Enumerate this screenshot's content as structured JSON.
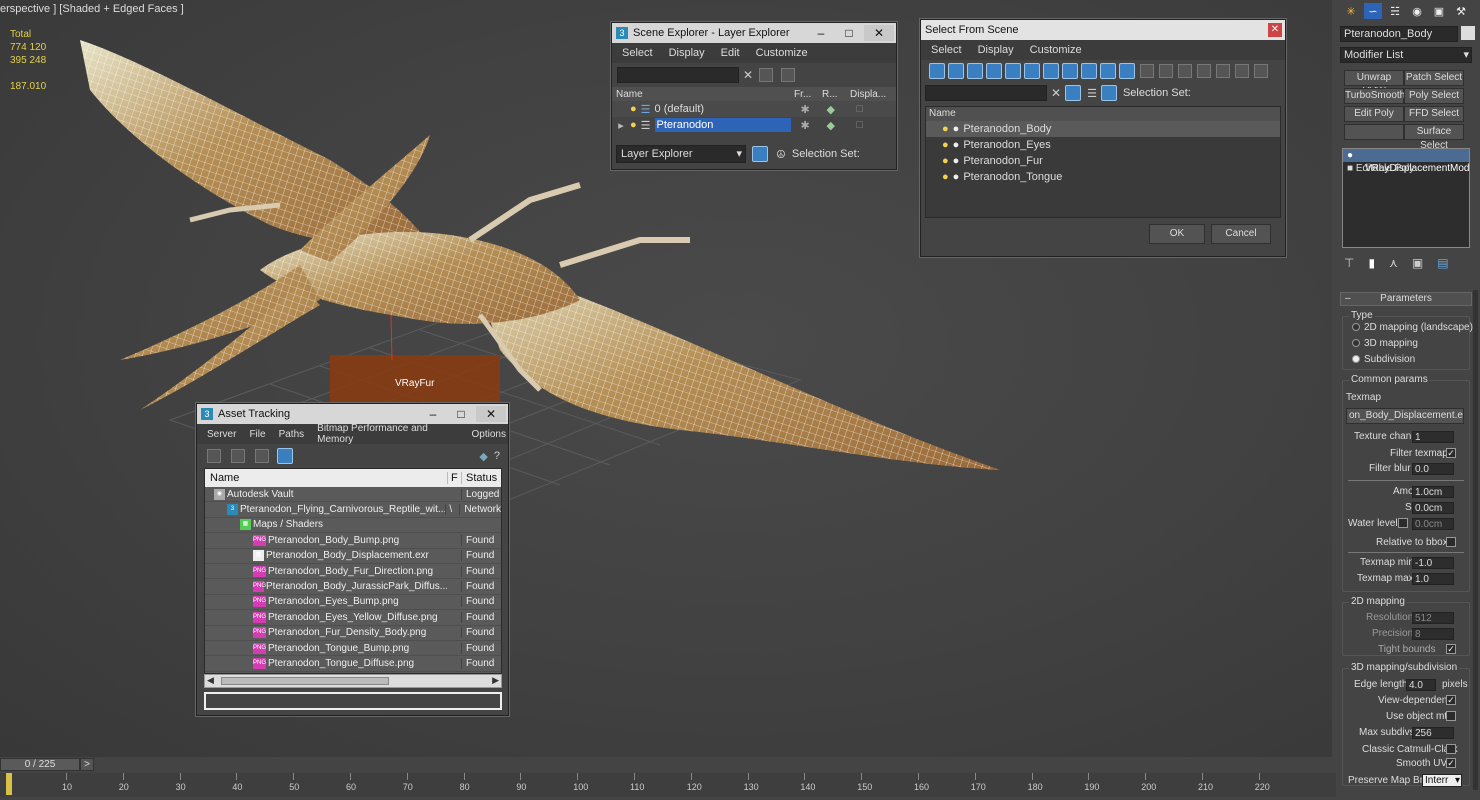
{
  "viewport": {
    "label": "erspective ] [Shaded + Edged Faces ]",
    "stats": {
      "total_label": "Total",
      "line1": "774 120",
      "line2": "395 248",
      "fps": "187.010"
    },
    "object_label": "VRayFur"
  },
  "scene_explorer": {
    "title": "Scene Explorer - Layer Explorer",
    "menus": [
      "Select",
      "Display",
      "Edit",
      "Customize"
    ],
    "columns": [
      "Name",
      "Fr...",
      "R...",
      "Displa..."
    ],
    "rows": [
      {
        "name": "0 (default)",
        "selected": false
      },
      {
        "name": "Pteranodon",
        "selected": true
      }
    ],
    "footer_dropdown": "Layer Explorer",
    "selection_set_label": "Selection Set:"
  },
  "select_from_scene": {
    "title": "Select From Scene",
    "menus": [
      "Select",
      "Display",
      "Customize"
    ],
    "selection_set_label": "Selection Set:",
    "column": "Name",
    "rows": [
      "Pteranodon_Body",
      "Pteranodon_Eyes",
      "Pteranodon_Fur",
      "Pteranodon_Tongue"
    ],
    "ok_label": "OK",
    "cancel_label": "Cancel"
  },
  "asset_tracking": {
    "title": "Asset Tracking",
    "menus": [
      "Server",
      "File",
      "Paths",
      "Bitmap Performance and Memory",
      "Options"
    ],
    "columns": [
      "Name",
      "F",
      "Status"
    ],
    "rows": [
      {
        "name": "Autodesk Vault",
        "f": "",
        "status": "Logged",
        "indent": 1,
        "icon": "vault"
      },
      {
        "name": "Pteranodon_Flying_Carnivorous_Reptile_wit...",
        "f": "\\",
        "status": "Network",
        "indent": 2,
        "icon": "max"
      },
      {
        "name": "Maps / Shaders",
        "f": "",
        "status": "",
        "indent": 3,
        "icon": "maps"
      },
      {
        "name": "Pteranodon_Body_Bump.png",
        "f": "",
        "status": "Found",
        "indent": 4,
        "icon": "png"
      },
      {
        "name": "Pteranodon_Body_Displacement.exr",
        "f": "",
        "status": "Found",
        "indent": 4,
        "icon": "exr"
      },
      {
        "name": "Pteranodon_Body_Fur_Direction.png",
        "f": "",
        "status": "Found",
        "indent": 4,
        "icon": "png"
      },
      {
        "name": "Pteranodon_Body_JurassicPark_Diffus...",
        "f": "",
        "status": "Found",
        "indent": 4,
        "icon": "png"
      },
      {
        "name": "Pteranodon_Eyes_Bump.png",
        "f": "",
        "status": "Found",
        "indent": 4,
        "icon": "png"
      },
      {
        "name": "Pteranodon_Eyes_Yellow_Diffuse.png",
        "f": "",
        "status": "Found",
        "indent": 4,
        "icon": "png"
      },
      {
        "name": "Pteranodon_Fur_Density_Body.png",
        "f": "",
        "status": "Found",
        "indent": 4,
        "icon": "png"
      },
      {
        "name": "Pteranodon_Tongue_Bump.png",
        "f": "",
        "status": "Found",
        "indent": 4,
        "icon": "png"
      },
      {
        "name": "Pteranodon_Tongue_Diffuse.png",
        "f": "",
        "status": "Found",
        "indent": 4,
        "icon": "png"
      }
    ]
  },
  "command_panel": {
    "object_name": "Pteranodon_Body",
    "modifier_list": "Modifier List",
    "modifier_buttons": [
      "Unwrap UVW",
      "Patch Select",
      "TurboSmooth",
      "Poly Select",
      "Edit Poly",
      "FFD Select",
      "",
      "Surface Select"
    ],
    "stack": [
      "VRayDisplacementMod",
      "Editable Poly"
    ],
    "rollout_title": "Parameters",
    "type_group": "Type",
    "type_options": [
      {
        "label": "2D mapping (landscape)",
        "on": false
      },
      {
        "label": "3D mapping",
        "on": false
      },
      {
        "label": "Subdivision",
        "on": true
      }
    ],
    "common_group": "Common params",
    "texmap_label": "Texmap",
    "texmap_value": "on_Body_Displacement.exr)",
    "texture_chan_label": "Texture chan",
    "texture_chan_value": "1",
    "filter_texmap_label": "Filter texmap",
    "filter_blur_label": "Filter blur",
    "filter_blur_value": "0.0",
    "amount_label": "Amount",
    "amount_value": "1.0cm",
    "shift_label": "Shift",
    "shift_value": "0.0cm",
    "water_level_label": "Water level",
    "water_level_value": "0.0cm",
    "relative_bbox_label": "Relative to bbox",
    "texmap_min_label": "Texmap min",
    "texmap_min_value": "-1.0",
    "texmap_max_label": "Texmap max",
    "texmap_max_value": "1.0",
    "group_2d": "2D mapping",
    "resolution_label": "Resolution",
    "resolution_value": "512",
    "precision_label": "Precision",
    "precision_value": "8",
    "tight_bounds_label": "Tight bounds",
    "group_3d": "3D mapping/subdivision",
    "edge_length_label": "Edge length",
    "edge_length_value": "4.0",
    "pixels_label": "pixels",
    "view_dependent_label": "View-dependent",
    "use_object_mtl_label": "Use object mtl",
    "max_subdivs_label": "Max subdivs",
    "max_subdivs_value": "256",
    "classic_catmull_label": "Classic Catmull-Clark",
    "smooth_uvs_label": "Smooth UVs",
    "preserve_map_label": "Preserve Map Bnd",
    "preserve_map_value": "Interr"
  },
  "timeline": {
    "frame_label": "0 / 225",
    "next_label": ">",
    "ticks": [
      "10",
      "20",
      "30",
      "40",
      "50",
      "60",
      "70",
      "80",
      "90",
      "100",
      "110",
      "120",
      "130",
      "140",
      "150",
      "160",
      "170",
      "180",
      "190",
      "200",
      "210",
      "220"
    ]
  }
}
